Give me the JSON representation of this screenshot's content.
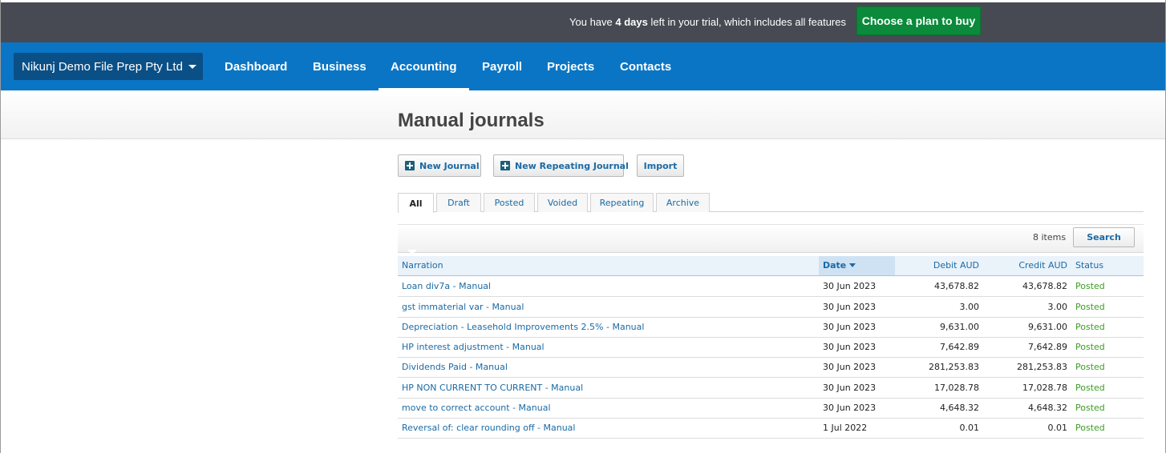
{
  "trial": {
    "prefix": "You have ",
    "days": "4 days",
    "suffix": " left in your trial, which includes all features",
    "button": "Choose a plan to buy"
  },
  "nav": {
    "org": "Nikunj Demo File Prep Pty Ltd",
    "items": [
      "Dashboard",
      "Business",
      "Accounting",
      "Payroll",
      "Projects",
      "Contacts"
    ],
    "active": "Accounting"
  },
  "page": {
    "title": "Manual journals"
  },
  "actions": {
    "new_journal": "New Journal",
    "new_repeating": "New Repeating Journal",
    "import": "Import"
  },
  "tabs": [
    "All",
    "Draft",
    "Posted",
    "Voided",
    "Repeating",
    "Archive"
  ],
  "toolbar": {
    "count": "8 items",
    "search": "Search"
  },
  "table": {
    "headers": {
      "narration": "Narration",
      "date": "Date",
      "debit": "Debit AUD",
      "credit": "Credit AUD",
      "status": "Status"
    },
    "rows": [
      {
        "narration": "Loan div7a - Manual",
        "date": "30 Jun 2023",
        "debit": "43,678.82",
        "credit": "43,678.82",
        "status": "Posted"
      },
      {
        "narration": "gst immaterial var - Manual",
        "date": "30 Jun 2023",
        "debit": "3.00",
        "credit": "3.00",
        "status": "Posted"
      },
      {
        "narration": "Depreciation - Leasehold Improvements 2.5% - Manual",
        "date": "30 Jun 2023",
        "debit": "9,631.00",
        "credit": "9,631.00",
        "status": "Posted"
      },
      {
        "narration": "HP interest adjustment - Manual",
        "date": "30 Jun 2023",
        "debit": "7,642.89",
        "credit": "7,642.89",
        "status": "Posted"
      },
      {
        "narration": "Dividends Paid - Manual",
        "date": "30 Jun 2023",
        "debit": "281,253.83",
        "credit": "281,253.83",
        "status": "Posted"
      },
      {
        "narration": "HP NON CURRENT TO CURRENT - Manual",
        "date": "30 Jun 2023",
        "debit": "17,028.78",
        "credit": "17,028.78",
        "status": "Posted"
      },
      {
        "narration": "move to correct account - Manual",
        "date": "30 Jun 2023",
        "debit": "4,648.32",
        "credit": "4,648.32",
        "status": "Posted"
      },
      {
        "narration": "Reversal of: clear rounding off - Manual",
        "date": "1 Jul 2022",
        "debit": "0.01",
        "credit": "0.01",
        "status": "Posted"
      }
    ]
  },
  "colors": {
    "nav": "#0a75c4",
    "trial_bar": "#474a53",
    "cta": "#0a8a3a",
    "link": "#1a6aa5",
    "posted": "#3a9d23"
  },
  "icons": {
    "add": "plus-square-icon",
    "dropdown": "caret-down-icon",
    "sort": "sort-desc-icon"
  }
}
